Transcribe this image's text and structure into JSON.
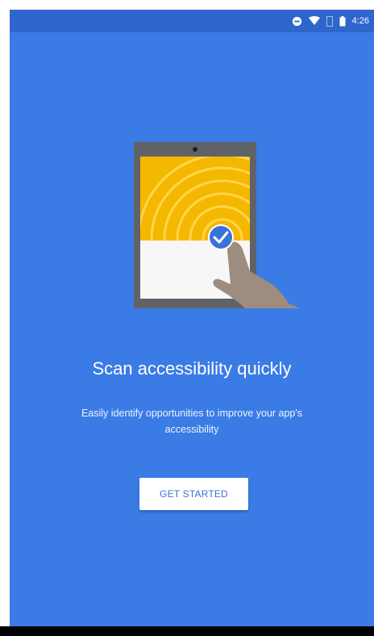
{
  "status_bar": {
    "time": "4:26",
    "icons": [
      "minus-circle-icon",
      "wifi-icon",
      "signal-icon",
      "battery-icon"
    ]
  },
  "onboarding": {
    "title": "Scan accessibility quickly",
    "subtitle": "Easily identify opportunities to improve your app's accessibility",
    "cta_label": "GET STARTED"
  },
  "colors": {
    "background": "#3a7be6",
    "status_bar": "#2f66cc",
    "accent_yellow": "#f5b800",
    "check_badge": "#3a73d8",
    "button_text": "#3a73d8"
  }
}
